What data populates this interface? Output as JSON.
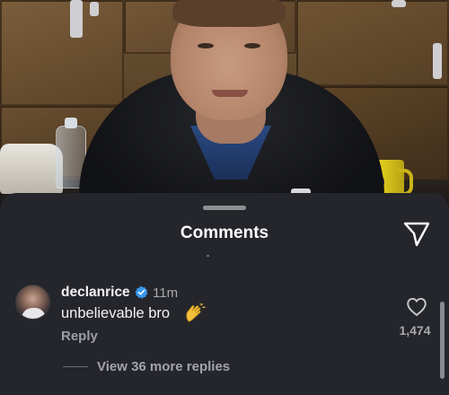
{
  "photo": {
    "description_icon": "background-photo"
  },
  "sheet": {
    "title": "Comments",
    "share_icon": "send-icon"
  },
  "comment": {
    "username": "declanrice",
    "verified_icon": "verified-badge-icon",
    "timestamp": "11m",
    "text": "unbelievable bro",
    "emoji_icon": "clapping-hands-icon",
    "reply_label": "Reply",
    "like_icon": "heart-outline-icon",
    "like_count": "1,474"
  },
  "replies": {
    "label": "View 36 more replies"
  },
  "colors": {
    "sheet_bg": "#25262b",
    "verified_blue": "#3897f0",
    "muted_text": "#a8a9ad"
  }
}
